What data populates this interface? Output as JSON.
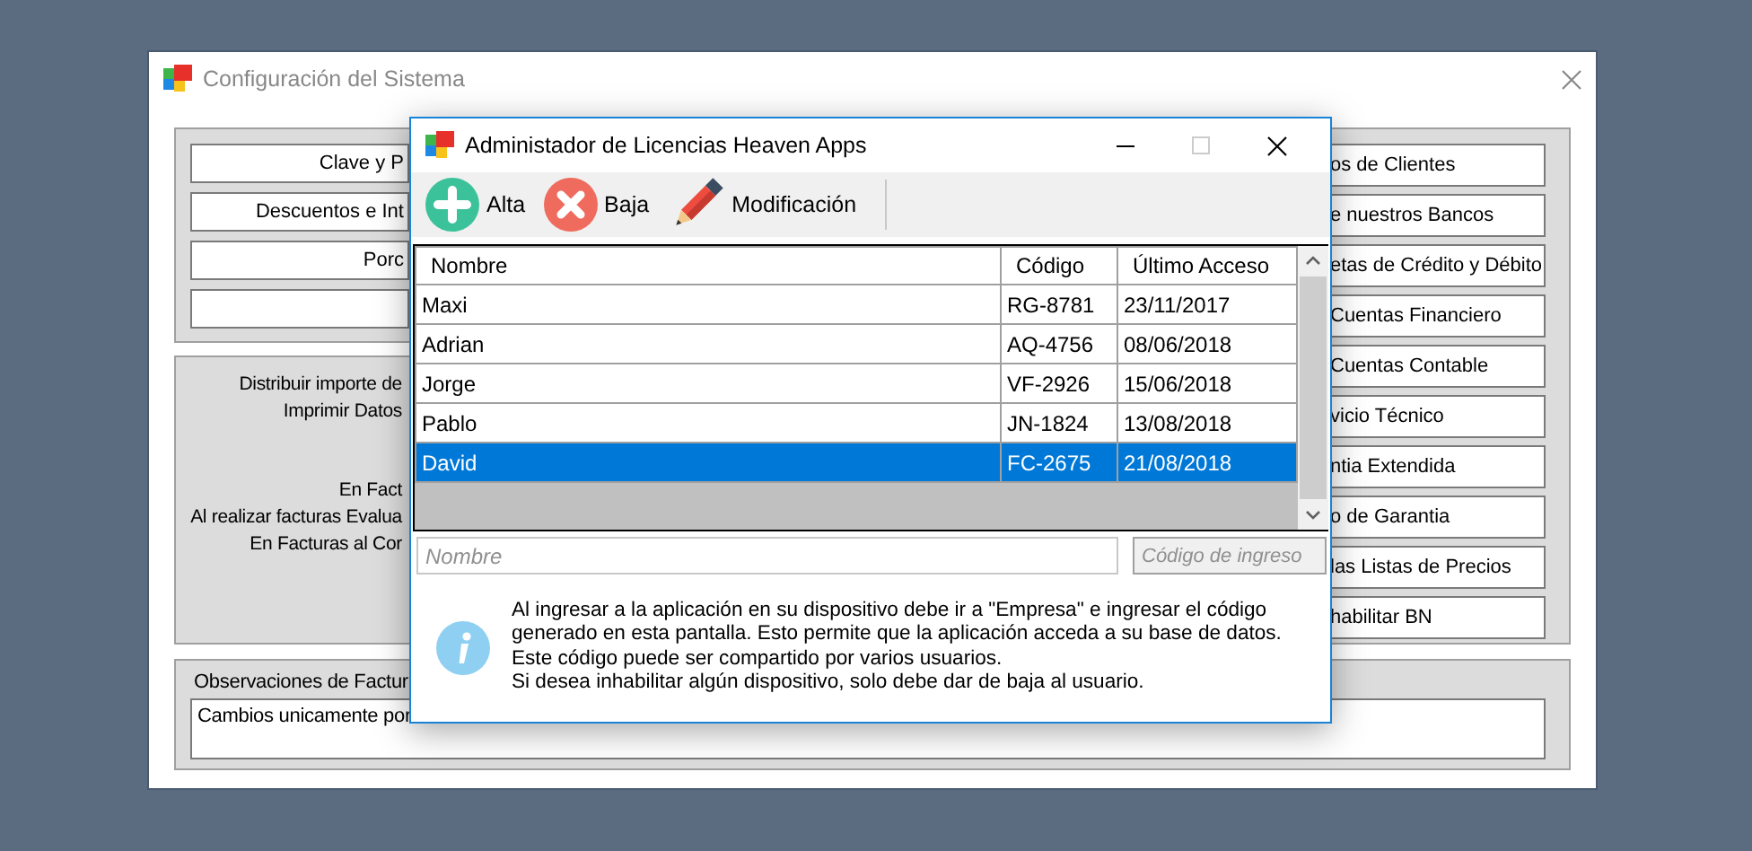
{
  "main_window": {
    "title": "Configuración del Sistema",
    "left_buttons": [
      {
        "kind": "text",
        "label": "Clave y P"
      },
      {
        "kind": "text",
        "label": "Descuentos e Int"
      },
      {
        "kind": "text",
        "label": "Porc"
      },
      {
        "kind": "blank"
      }
    ],
    "option_lines": [
      "Distribuir importe de",
      "Imprimir Datos",
      "En Fact",
      "Al realizar facturas Evalua",
      "En Facturas al Cor"
    ],
    "right_buttons": [
      "os de Clientes",
      "e nuestros Bancos",
      "etas de Crédito y Débito",
      "Cuentas Financiero",
      "Cuentas Contable",
      "vicio Técnico",
      "ntia Extendida",
      "o de Garantia",
      "las Listas de Precios",
      "habilitar BN"
    ],
    "observations": {
      "label": "Observaciones de Factur",
      "value": "Cambios unicamente por"
    }
  },
  "dialog": {
    "title": "Administador de Licencias Heaven Apps",
    "toolbar": [
      {
        "kind": "add",
        "label": "Alta"
      },
      {
        "kind": "delete",
        "label": "Baja"
      },
      {
        "kind": "edit",
        "label": "Modificación"
      }
    ],
    "table": {
      "columns": [
        "Nombre",
        "Código",
        "Último Acceso"
      ],
      "rows": [
        {
          "cells": [
            "Maxi",
            "RG-8781",
            "23/11/2017"
          ],
          "selected": false
        },
        {
          "cells": [
            "Adrian",
            "AQ-4756",
            "08/06/2018"
          ],
          "selected": false
        },
        {
          "cells": [
            "Jorge",
            "VF-2926",
            "15/06/2018"
          ],
          "selected": false
        },
        {
          "cells": [
            "Pablo",
            "JN-1824",
            "13/08/2018"
          ],
          "selected": false
        },
        {
          "cells": [
            "David",
            "FC-2675",
            "21/08/2018"
          ],
          "selected": true
        }
      ]
    },
    "name_field": {
      "placeholder": "Nombre"
    },
    "code_field": {
      "placeholder": "Código de ingreso",
      "disabled": true
    },
    "info_text": "Al ingresar a la aplicación en su dispositivo debe ir a \"Empresa\" e ingresar el código\ngenerado en esta pantalla. Esto permite que la aplicación acceda a su base de datos.\nEste código puede ser compartido por varios usuarios.\nSi desea inhabilitar algún dispositivo, solo debe dar de baja al usuario."
  }
}
